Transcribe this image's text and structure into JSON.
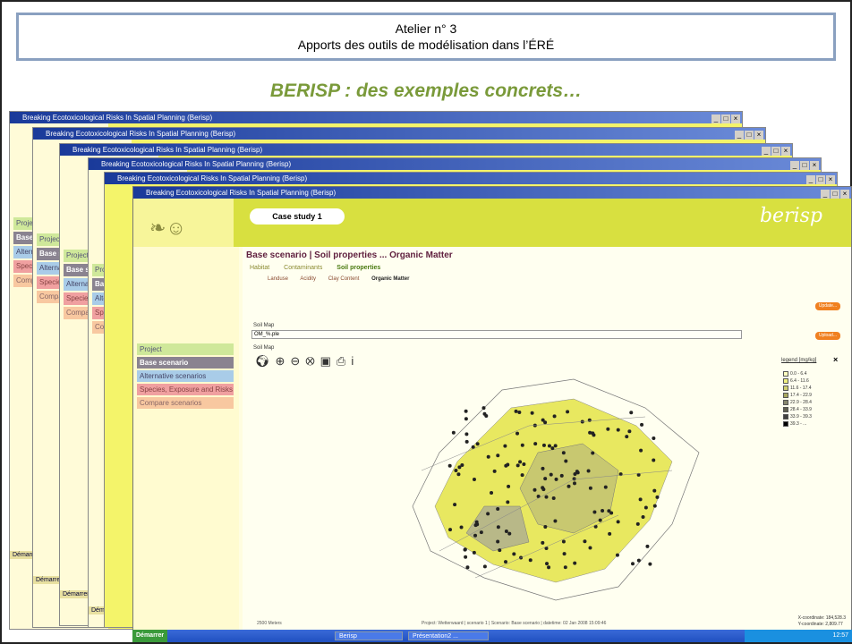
{
  "slide": {
    "header_line1": "Atelier n° 3",
    "header_line2": "Apports des outils de modélisation dans l’ÉRÉ",
    "subtitle": "BERISP : des exemples concrets…"
  },
  "window": {
    "title": "Breaking Ecotoxicological Risks In Spatial Planning (Berisp)",
    "controls": [
      "_",
      "□",
      "×"
    ]
  },
  "nav": {
    "project": "Project",
    "base": "Base scenario",
    "alternative": "Alternative scenarios",
    "species": "Species, Exposure and Risks",
    "compare": "Compare scenarios"
  },
  "banner": {
    "case": "Case study 1",
    "logo": "berisp"
  },
  "main": {
    "breadcrumb": "Base scenario | Soil properties ... Organic Matter",
    "tabs": [
      "Habitat",
      "Contaminants",
      "Soil properties"
    ],
    "subtabs": [
      "Landuse",
      "Acidity",
      "Clay Content",
      "Organic Matter"
    ],
    "button1": "Update...",
    "button2": "Upload...",
    "soil_map_label": "Soil Map",
    "soil_map_value": "OM_%.ple",
    "soil_map_label2": "Soil Map",
    "legend_title": "legend [mg/kg]",
    "legend_close": "×",
    "legend": [
      "0.0 - 6.4",
      "6.4 - 11.6",
      "11.6 - 17.4",
      "17.4 - 22.9",
      "22.9 - 28.4",
      "28.4 - 33.9",
      "33.9 - 39.3",
      "39.3 - ..."
    ],
    "status_left": "2500 Meters",
    "status_mid": "Project: Wetterwaard | scenario 1 | Scenario: Base scenario | datetime: 02 Jan 2008 15:09:46",
    "coord_x": "X-coordinate: 184,528.3",
    "coord_y": "Y-coordinate: 2,809.77"
  },
  "taskbar": {
    "start": "Démarrer",
    "task1": "Berisp",
    "task2": "Présentation2 ...",
    "clock": "12:57"
  }
}
